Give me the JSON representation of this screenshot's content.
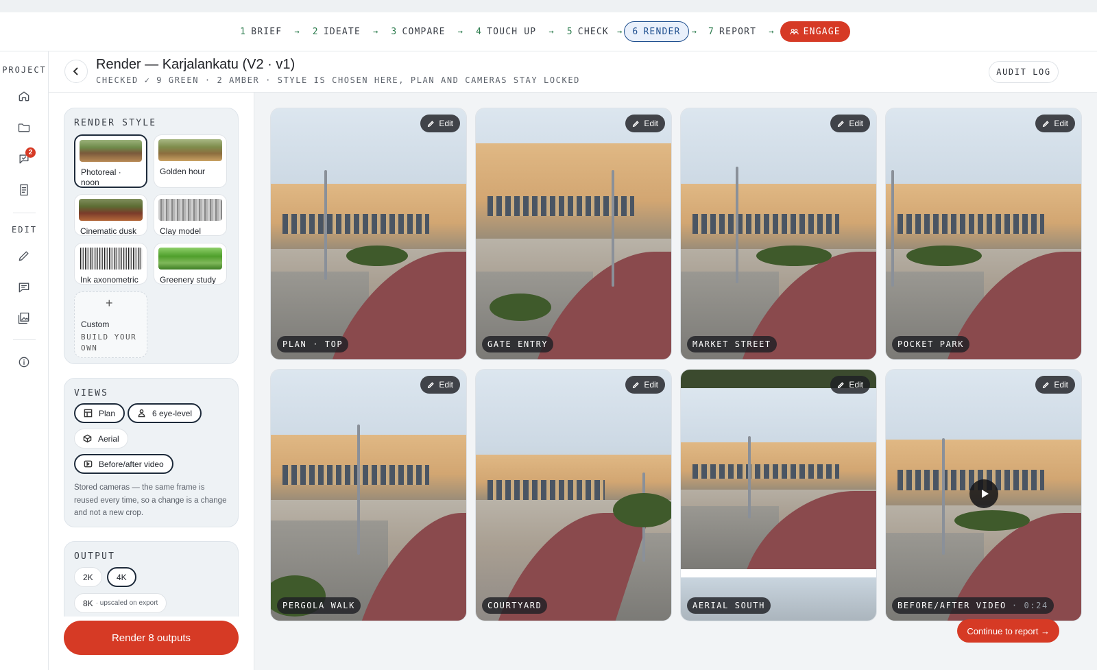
{
  "steps": [
    {
      "num": "1",
      "label": "BRIEF"
    },
    {
      "num": "2",
      "label": "IDEATE"
    },
    {
      "num": "3",
      "label": "COMPARE"
    },
    {
      "num": "4",
      "label": "TOUCH UP"
    },
    {
      "num": "5",
      "label": "CHECK"
    },
    {
      "num": "6",
      "label": "RENDER"
    },
    {
      "num": "7",
      "label": "REPORT"
    }
  ],
  "engage_label": "ENGAGE",
  "arrow": "→",
  "rail": {
    "project_label": "PROJECT",
    "edit_label": "EDIT",
    "review_badge": "2"
  },
  "header": {
    "title": "Render — Karjalankatu (V2 · v1)",
    "subtitle": "CHECKED ✓ 9 GREEN · 2 AMBER · STYLE IS CHOSEN HERE, PLAN AND CAMERAS STAY LOCKED",
    "audit_label": "AUDIT LOG"
  },
  "render_style": {
    "title": "RENDER STYLE",
    "styles": [
      {
        "label": "Photoreal · noon",
        "selected": true
      },
      {
        "label": "Golden hour",
        "selected": false
      },
      {
        "label": "Cinematic dusk",
        "selected": false
      },
      {
        "label": "Clay model",
        "selected": false
      },
      {
        "label": "Ink axonometric",
        "selected": false
      },
      {
        "label": "Greenery study",
        "selected": false
      }
    ],
    "custom": {
      "plus": "+",
      "label": "Custom",
      "sub": "BUILD YOUR OWN"
    }
  },
  "views": {
    "title": "VIEWS",
    "plan": "Plan",
    "eye_level": "6 eye-level",
    "aerial": "Aerial",
    "video": "Before/after video",
    "note": "Stored cameras — the same frame is reused every time, so a change is a change and not a new crop."
  },
  "output": {
    "title": "OUTPUT",
    "r2k": "2K",
    "r4k": "4K",
    "r8k": "8K",
    "r8k_note": "· upscaled on export"
  },
  "render_button": "Render 8 outputs",
  "edit_label": "Edit",
  "tiles": [
    {
      "caption": "PLAN · TOP"
    },
    {
      "caption": "GATE ENTRY"
    },
    {
      "caption": "MARKET STREET"
    },
    {
      "caption": "POCKET PARK"
    },
    {
      "caption": "PERGOLA WALK"
    },
    {
      "caption": "COURTYARD"
    },
    {
      "caption": "AERIAL SOUTH"
    },
    {
      "caption": "BEFORE/AFTER VIDEO",
      "duration": "· 0:24"
    }
  ],
  "continue_label": "Continue to report →",
  "colors": {
    "accent": "#d63a25",
    "active_step": "#1f4f8f",
    "step_num": "#2e7d4f"
  }
}
